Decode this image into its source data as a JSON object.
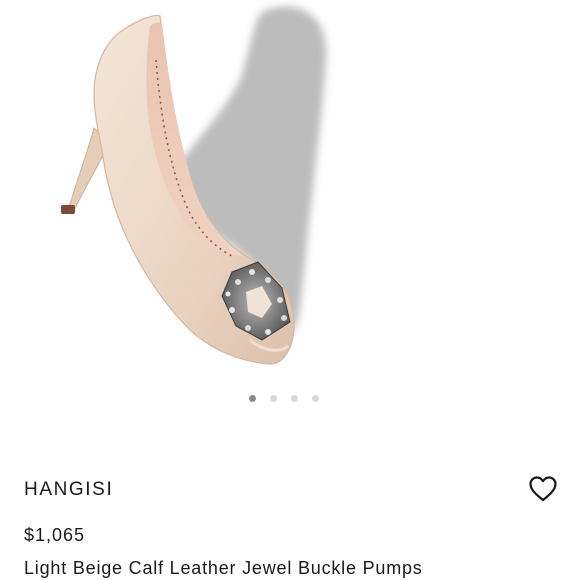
{
  "product": {
    "brand": "HANGISI",
    "price": "$1,065",
    "name": "Light Beige Calf Leather Jewel Buckle Pumps"
  },
  "carousel": {
    "total_images": 4,
    "active_index": 0
  },
  "icons": {
    "wishlist": "heart-outline-icon"
  },
  "colors": {
    "shoe": "#ecd8c6",
    "background": "#ffffff",
    "text": "#1a1a1a"
  }
}
